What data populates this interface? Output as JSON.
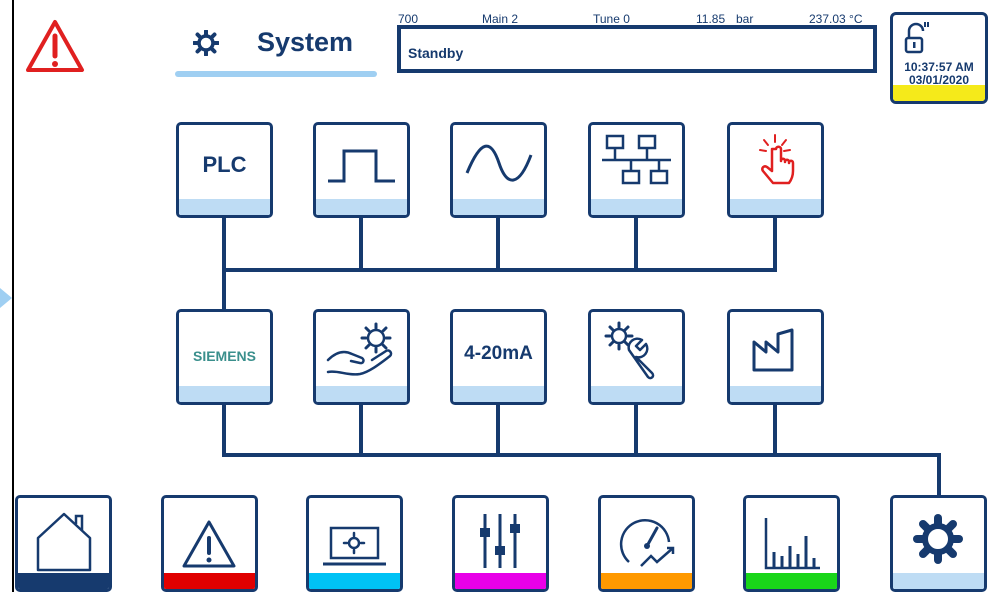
{
  "header": {
    "title": "System",
    "status_text": "Standby",
    "status_labels": [
      "700",
      "Main 2",
      "Tune 0",
      "11.85",
      "bar",
      "237.03 °C"
    ],
    "time": "10:37:57 AM",
    "date": "03/01/2020"
  },
  "top_row_tiles": [
    {
      "name": "plc",
      "label": "PLC"
    },
    {
      "name": "pulse",
      "label": ""
    },
    {
      "name": "sine",
      "label": ""
    },
    {
      "name": "network",
      "label": ""
    },
    {
      "name": "touch",
      "label": ""
    }
  ],
  "middle_row_tiles": [
    {
      "name": "siemens",
      "label": "SIEMENS"
    },
    {
      "name": "maintenance",
      "label": ""
    },
    {
      "name": "analog",
      "label": "4-20mA"
    },
    {
      "name": "service",
      "label": ""
    },
    {
      "name": "plant",
      "label": ""
    }
  ],
  "bottom_nav": [
    {
      "name": "home",
      "accent": "#163a6e"
    },
    {
      "name": "alarms",
      "accent": "#e00000"
    },
    {
      "name": "monitor",
      "accent": "#00c2f5"
    },
    {
      "name": "settings",
      "accent": "#e800e8"
    },
    {
      "name": "performance",
      "accent": "#ff9900"
    },
    {
      "name": "trends",
      "accent": "#19d619"
    },
    {
      "name": "system",
      "accent": "#bedcf4"
    }
  ],
  "colors": {
    "primary": "#163a6e",
    "tile_bar": "#bedcf4",
    "alarm_red": "#e02020",
    "status_yellow": "#f5ea1a"
  }
}
